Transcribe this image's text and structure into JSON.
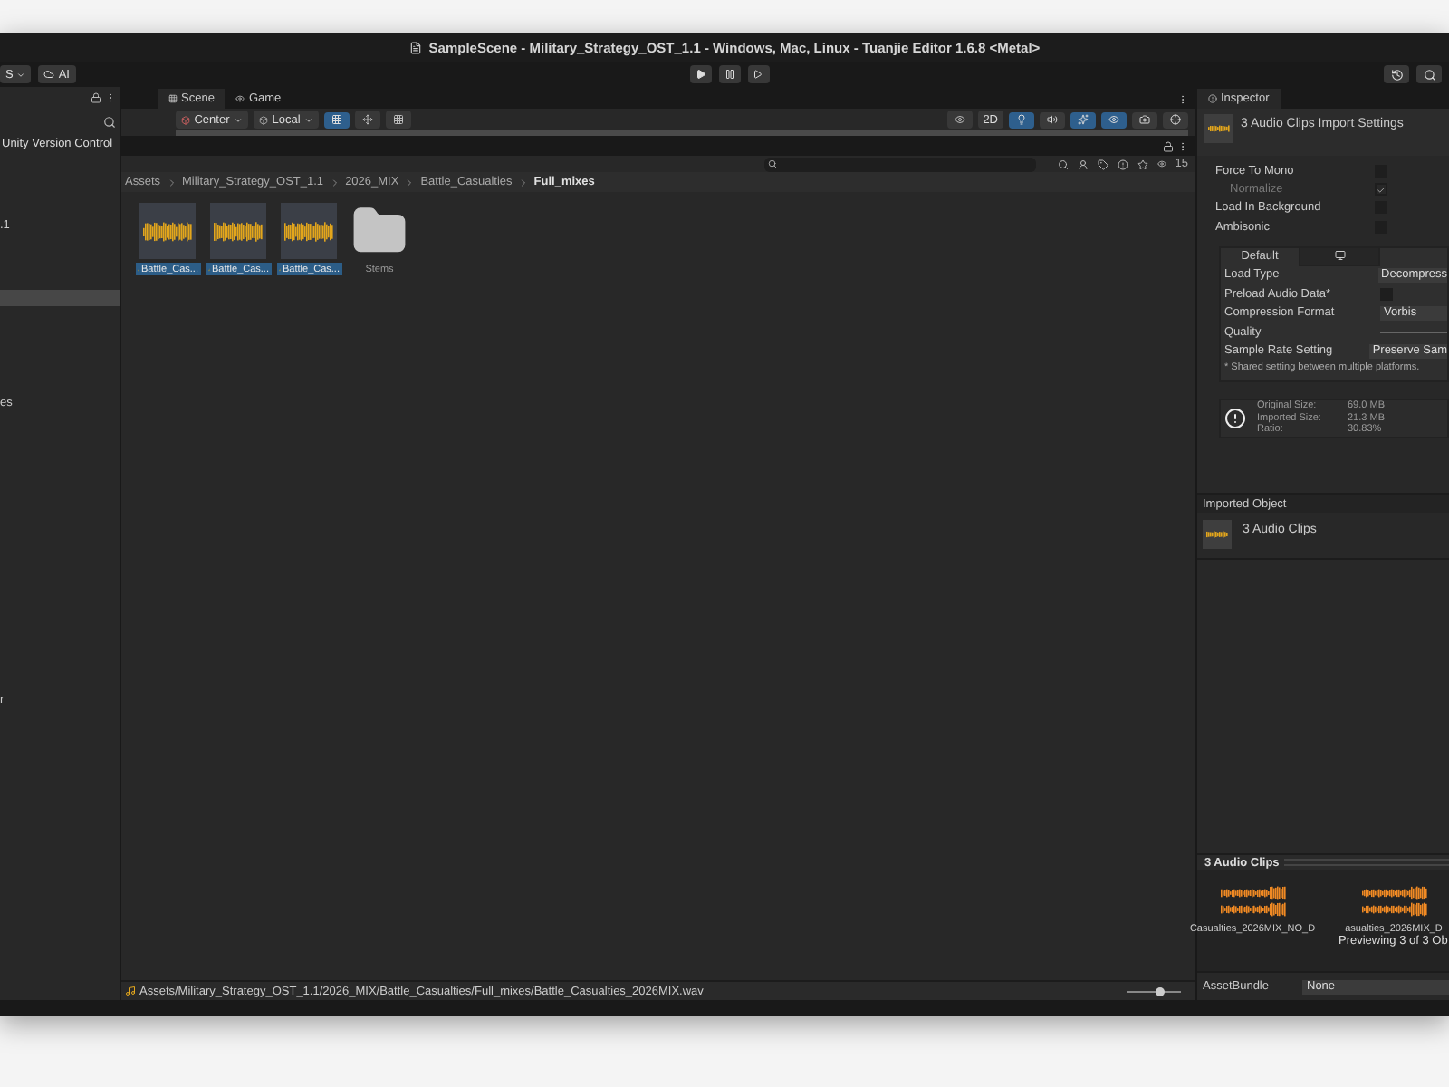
{
  "window": {
    "title": "SampleScene - Military_Strategy_OST_1.1 - Windows, Mac, Linux - Tuanjie Editor 1.6.8 <Metal>"
  },
  "toolbar": {
    "account_label": "S",
    "ai_label": "AI"
  },
  "left_panel": {
    "version_control": "Unity Version Control",
    "rows": [
      {
        "label": ".1",
        "selected": false
      },
      {
        "selected": true
      },
      {
        "label": "es",
        "selected": false
      },
      {
        "label": "r",
        "selected": false
      }
    ]
  },
  "scene_tabs": [
    {
      "label": "Scene",
      "selected": true
    },
    {
      "label": "Game",
      "selected": false
    }
  ],
  "scene_toolbar": {
    "pivot": "Center",
    "space": "Local",
    "mode_2d": "2D",
    "toggles": [
      {
        "kind": "light",
        "on": true
      },
      {
        "kind": "audio",
        "on": false
      },
      {
        "kind": "effects",
        "on": true
      },
      {
        "kind": "visibility",
        "on": true
      },
      {
        "kind": "camera",
        "on": false
      },
      {
        "kind": "gizmos",
        "on": false
      }
    ]
  },
  "project": {
    "count": "15",
    "breadcrumb": [
      "Assets",
      "Military_Strategy_OST_1.1",
      "2026_MIX",
      "Battle_Casualties",
      "Full_mixes"
    ],
    "items": [
      {
        "kind": "audio",
        "label": "Battle_Cas...",
        "selected": true
      },
      {
        "kind": "audio",
        "label": "Battle_Cas...",
        "selected": true
      },
      {
        "kind": "audio",
        "label": "Battle_Cas...",
        "selected": true
      },
      {
        "kind": "folder",
        "label": "Stems",
        "selected": false
      }
    ],
    "status_path": "Assets/Military_Strategy_OST_1.1/2026_MIX/Battle_Casualties/Full_mixes/Battle_Casualties_2026MIX.wav",
    "zoom": {
      "level": 0.6
    }
  },
  "inspector": {
    "tab": "Inspector",
    "title": "3 Audio Clips Import Settings",
    "options": [
      {
        "label": "Force To Mono",
        "checked": false,
        "disabled": false
      },
      {
        "label": "Normalize",
        "checked": true,
        "disabled": true
      },
      {
        "label": "Load In Background",
        "checked": false,
        "disabled": false
      },
      {
        "label": "Ambisonic",
        "checked": false,
        "disabled": false
      }
    ],
    "platform_tabs": [
      {
        "kind": "text",
        "label": "Default",
        "selected": true
      },
      {
        "kind": "monitor",
        "selected": false
      }
    ],
    "settings": [
      {
        "kind": "dropdown",
        "label": "Load Type",
        "value": "Decompress"
      },
      {
        "kind": "checkbox",
        "label": "Preload Audio Data*",
        "checked": false
      },
      {
        "kind": "dropdown",
        "label": "Compression Format",
        "value": "Vorbis"
      },
      {
        "kind": "slider",
        "label": "Quality"
      },
      {
        "kind": "dropdown",
        "label": "Sample Rate Setting",
        "value": "Preserve Sam"
      }
    ],
    "note": "* Shared setting between multiple platforms.",
    "sizes": [
      {
        "label": "Original Size:",
        "value": "69.0 MB"
      },
      {
        "label": "Imported Size:",
        "value": "21.3 MB"
      },
      {
        "label": "Ratio:",
        "value": "30.83%"
      }
    ],
    "imported_header": "Imported Object",
    "imported_name": "3 Audio Clips",
    "preview": {
      "header": "3 Audio Clips",
      "clips": [
        "Casualties_2026MIX_NO_D",
        "asualties_2026MIX_D"
      ],
      "caption": "Previewing 3 of 3 Ob"
    },
    "asset_bundle": {
      "label": "AssetBundle",
      "value": "None"
    }
  }
}
